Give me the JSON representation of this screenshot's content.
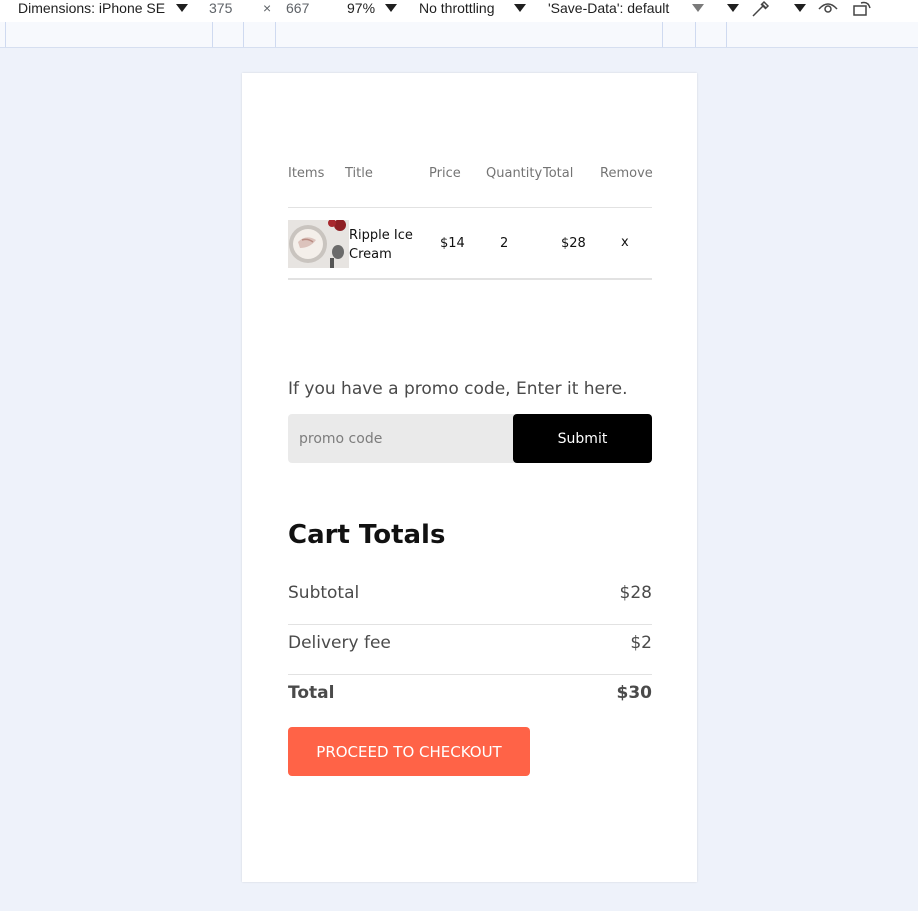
{
  "devtools": {
    "dimensions": "Dimensions: iPhone SE",
    "width": "375",
    "times": "×",
    "height": "667",
    "zoom": "97%",
    "throttling": "No throttling",
    "save_data": "'Save-Data': default",
    "icons": [
      "chevron-down-icon",
      "eyedropper-icon",
      "eye-icon",
      "rotate-icon"
    ]
  },
  "cart": {
    "headers": {
      "items": "Items",
      "title": "Title",
      "price": "Price",
      "quantity": "Quantity",
      "total": "Total",
      "remove": "Remove"
    },
    "rows": [
      {
        "title_line1": "Ripple Ice",
        "title_line2": "Cream",
        "price": "$14",
        "quantity": "2",
        "total": "$28",
        "remove": "x"
      }
    ]
  },
  "promo": {
    "prompt": "If you have a promo code, Enter it here.",
    "placeholder": "promo code",
    "submit_label": "Submit"
  },
  "totals": {
    "title": "Cart Totals",
    "subtotal_label": "Subtotal",
    "subtotal_value": "$28",
    "delivery_label": "Delivery fee",
    "delivery_value": "$2",
    "total_label": "Total",
    "total_value": "$30"
  },
  "checkout_label": "PROCEED TO CHECKOUT",
  "colors": {
    "page_bg": "#eef2fa",
    "accent": "#ff6347",
    "submit_bg": "#000000"
  }
}
